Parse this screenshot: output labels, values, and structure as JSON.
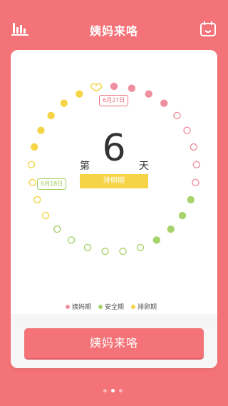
{
  "header": {
    "title": "姨妈来咯",
    "left_icon": "stats-bars-icon",
    "right_icon": "calendar-face-icon"
  },
  "cycle": {
    "day_prefix": "第",
    "day_number": "6",
    "day_suffix": "天",
    "phase": "排卵期",
    "tag_period_start": "6月27日",
    "tag_current_date": "6月18日",
    "total_dots": 29,
    "period_days": [
      1,
      2,
      3,
      4,
      5,
      6,
      7,
      8,
      9
    ],
    "safe_days": [
      10,
      11,
      12,
      13,
      14,
      15,
      16,
      17,
      18,
      19
    ],
    "ovulation_days": [
      20,
      21,
      22,
      23,
      24,
      25,
      26,
      27,
      28
    ],
    "special_heart_day": 29
  },
  "legend": {
    "period": "姨妈期",
    "safe": "安全期",
    "ovulation": "排卵期"
  },
  "colors": {
    "background": "#F47378",
    "period": "#EF8FA0",
    "safe": "#A8D36C",
    "ovulation": "#F5D547",
    "button": "#F47378"
  },
  "cta": {
    "label": "姨妈来咯"
  },
  "pager": {
    "count": 3,
    "active_index": 1
  }
}
